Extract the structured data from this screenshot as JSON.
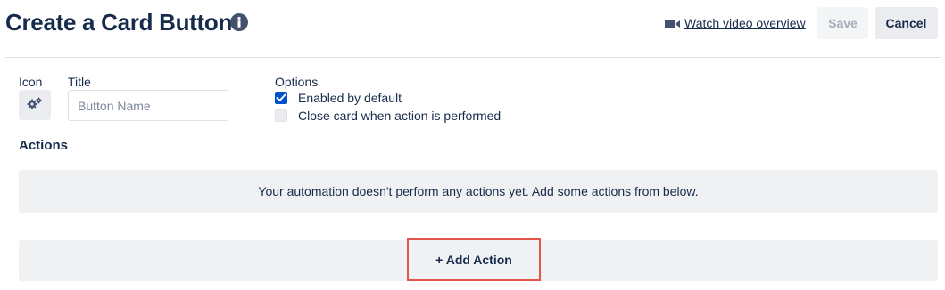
{
  "header": {
    "title": "Create a Card Button",
    "watch_link": "Watch video overview",
    "save_label": "Save",
    "cancel_label": "Cancel"
  },
  "form": {
    "icon_label": "Icon",
    "title_label": "Title",
    "title_placeholder": "Button Name",
    "title_value": "",
    "options_label": "Options",
    "options": [
      {
        "label": "Enabled by default",
        "checked": true
      },
      {
        "label": "Close card when action is performed",
        "checked": false
      }
    ]
  },
  "actions": {
    "heading": "Actions",
    "empty_message": "Your automation doesn't perform any actions yet. Add some actions from below.",
    "add_label": "+ Add Action"
  },
  "colors": {
    "checkbox_checked": "#0052cc",
    "highlight_border": "#e5534b",
    "text": "#172b4d"
  },
  "icons": {
    "info": "info-icon",
    "video": "video-camera-icon",
    "icon_picker": "gears-icon",
    "checkbox": "checkmark-icon"
  }
}
